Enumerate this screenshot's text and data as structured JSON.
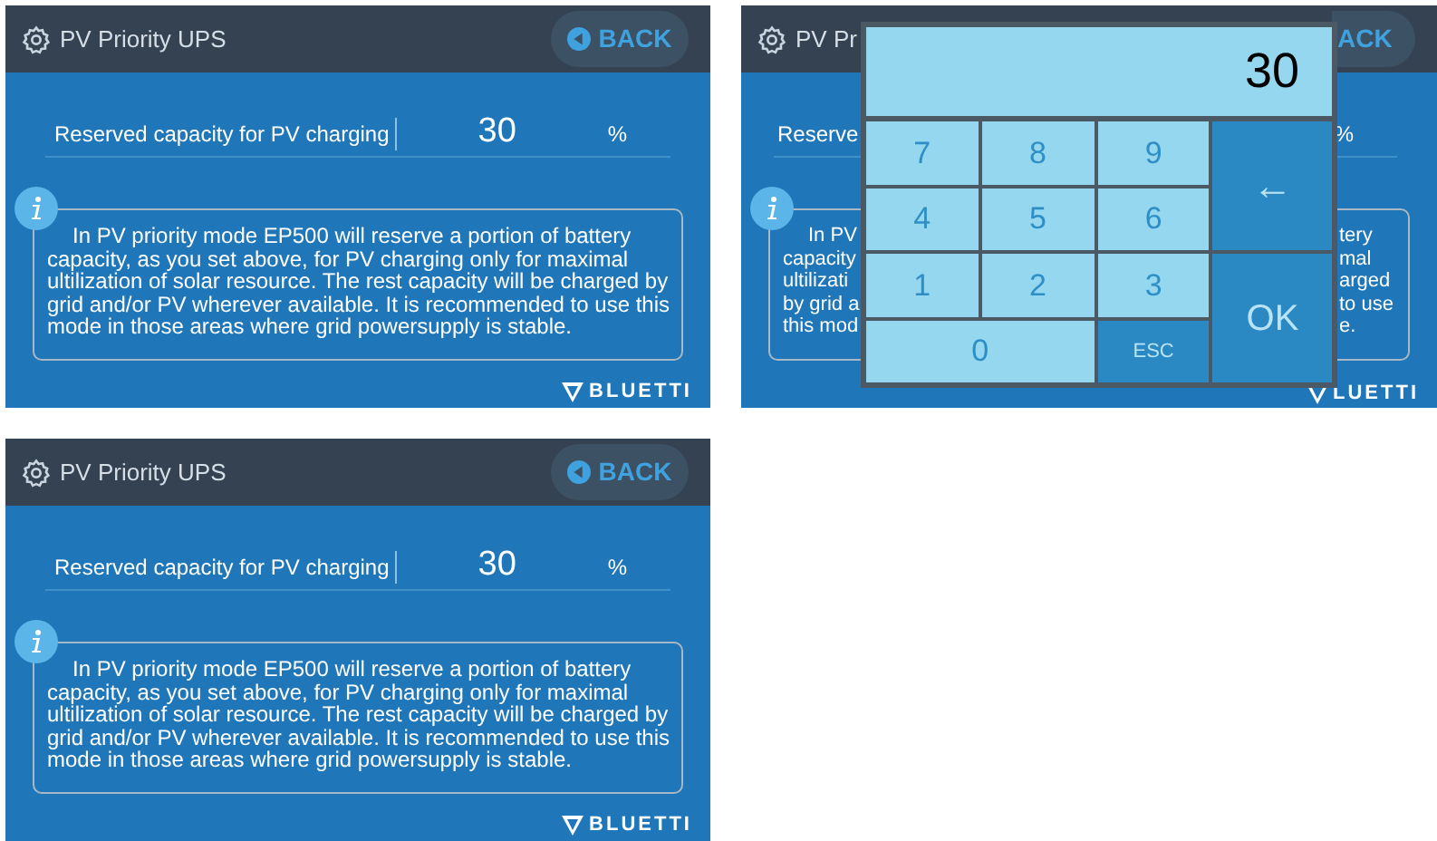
{
  "screens": [
    {
      "kind": "full",
      "title": "PV Priority UPS",
      "back_label": "BACK",
      "setting": {
        "label": "Reserved capacity for PV charging",
        "value": "30",
        "unit": "%"
      },
      "info_text": "In PV priority mode EP500 will reserve a portion of battery capacity, as you set above, for PV charging only for maximal ultilization of solar resource. The rest capacity will be charged by grid and/or PV wherever available. It is recommended to use this mode in those areas where grid powersupply is stable.",
      "logo": "BLUETTI"
    },
    {
      "kind": "covered",
      "title": "PV Pr",
      "back_label": "ACK",
      "setting": {
        "label": "Reserve",
        "unit": "%"
      },
      "info_lines": [
        {
          "left": "In PV",
          "right": "tery"
        },
        {
          "left": "capacity",
          "right": "mal"
        },
        {
          "left": "ultilizati",
          "right": "arged"
        },
        {
          "left": "by grid a",
          "right": "to use"
        },
        {
          "left": "this mod",
          "right": "e."
        }
      ],
      "logo": "LUETTI",
      "keypad": {
        "display": "30",
        "keys": [
          {
            "label": "7",
            "kind": "digit"
          },
          {
            "label": "8",
            "kind": "digit"
          },
          {
            "label": "9",
            "kind": "digit"
          },
          {
            "label": "←",
            "kind": "backspace"
          },
          {
            "label": "4",
            "kind": "digit"
          },
          {
            "label": "5",
            "kind": "digit"
          },
          {
            "label": "6",
            "kind": "digit"
          },
          {
            "label": "1",
            "kind": "digit"
          },
          {
            "label": "2",
            "kind": "digit"
          },
          {
            "label": "3",
            "kind": "digit"
          },
          {
            "label": "OK",
            "kind": "ok"
          },
          {
            "label": "0",
            "kind": "digit_wide"
          },
          {
            "label": "ESC",
            "kind": "esc"
          }
        ]
      }
    },
    {
      "kind": "full",
      "title": "PV Priority UPS",
      "back_label": "BACK",
      "setting": {
        "label": "Reserved capacity for PV charging",
        "value": "30",
        "unit": "%"
      },
      "info_text": "In PV priority mode EP500 will reserve a portion of battery capacity, as you set above, for PV charging only for maximal ultilization of solar resource. The rest capacity will be charged by grid and/or PV wherever available. It is recommended to use this mode in those areas where grid powersupply is stable.",
      "logo": "BLUETTI"
    }
  ]
}
